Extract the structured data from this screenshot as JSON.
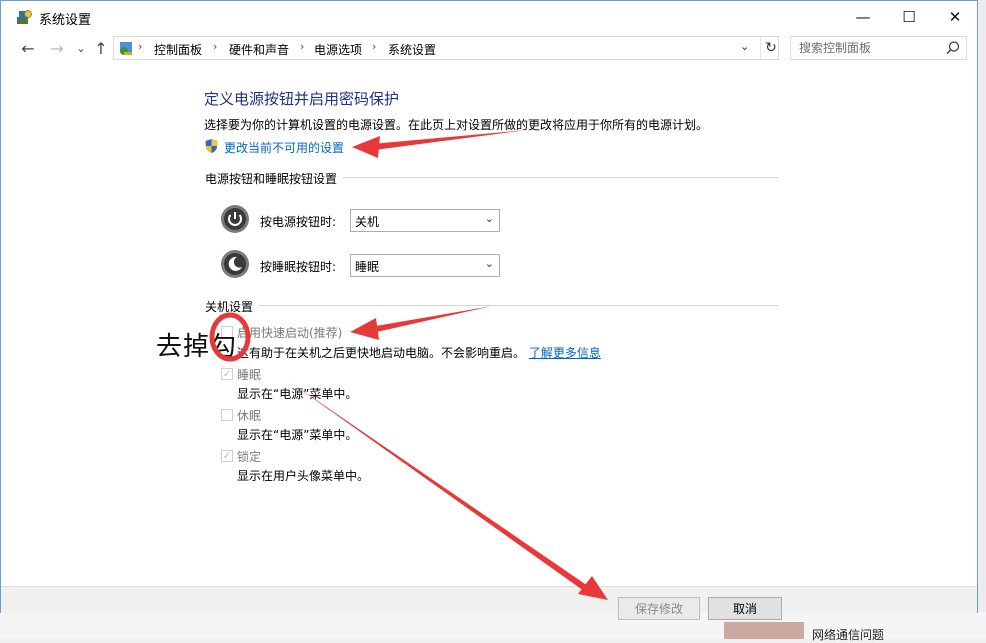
{
  "window": {
    "title": "系统设置",
    "minimize": "—",
    "maximize": "☐",
    "close": "✕"
  },
  "nav": {
    "back": "←",
    "forward": "→",
    "recent": "⌄",
    "up": "↑",
    "breadcrumbs": [
      "控制面板",
      "硬件和声音",
      "电源选项",
      "系统设置"
    ],
    "separator": "›",
    "dropdown": "⌄",
    "refresh": "↻",
    "search_placeholder": "搜索控制面板"
  },
  "page": {
    "heading": "定义电源按钮并启用密码保护",
    "description": "选择要为你的计算机设置的电源设置。在此页上对设置所做的更改将应用于你所有的电源计划。",
    "change_link": "更改当前不可用的设置"
  },
  "power_buttons": {
    "section_title": "电源按钮和睡眠按钮设置",
    "rows": [
      {
        "label": "按电源按钮时:",
        "value": "关机"
      },
      {
        "label": "按睡眠按钮时:",
        "value": "睡眠"
      }
    ]
  },
  "shutdown": {
    "section_title": "关机设置",
    "items": [
      {
        "label": "启用快速启动(推荐)",
        "checked": false,
        "desc": "这有助于在关机之后更快地启动电脑。不会影响重启。",
        "link": "了解更多信息"
      },
      {
        "label": "睡眠",
        "checked": true,
        "desc": "显示在“电源”菜单中。"
      },
      {
        "label": "休眠",
        "checked": false,
        "desc": "显示在“电源”菜单中。"
      },
      {
        "label": "锁定",
        "checked": true,
        "desc": "显示在用户头像菜单中。"
      }
    ]
  },
  "footer": {
    "save": "保存修改",
    "cancel": "取消"
  },
  "annotation": {
    "text": "去掉勾",
    "color": "#e8393a"
  },
  "background": {
    "bottom_text": "网络通信问题"
  }
}
